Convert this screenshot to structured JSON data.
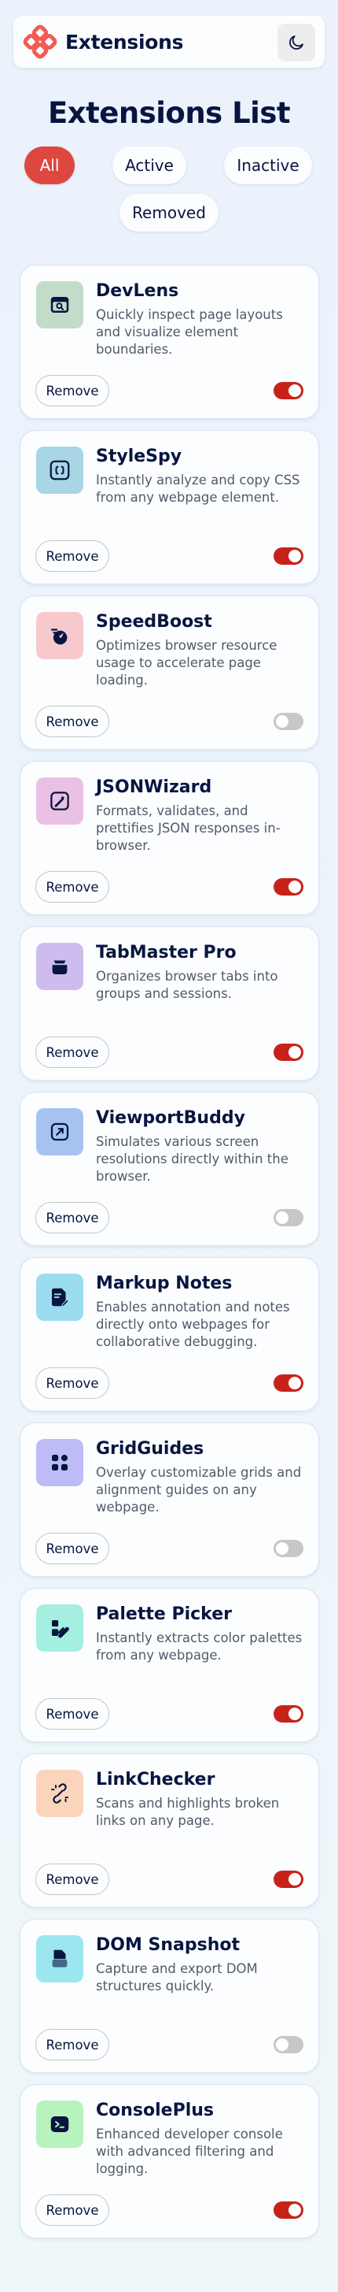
{
  "header": {
    "logo_text": "Extensions",
    "theme_icon": "moon-icon",
    "brand_color": "#f25c54"
  },
  "page": {
    "title": "Extensions List"
  },
  "filters": [
    {
      "label": "All",
      "active": true
    },
    {
      "label": "Active",
      "active": false
    },
    {
      "label": "Inactive",
      "active": false
    },
    {
      "label": "Removed",
      "active": false
    }
  ],
  "remove_label": "Remove",
  "colors": {
    "accent": "#de473f",
    "toggle_on": "#c7221a",
    "toggle_off": "#c7c7c7"
  },
  "extensions": [
    {
      "name": "DevLens",
      "description": "Quickly inspect page layouts and visualize element boundaries.",
      "enabled": true,
      "icon": "inspect-browser-icon",
      "icon_bg": "#c3dbc9"
    },
    {
      "name": "StyleSpy",
      "description": "Instantly analyze and copy CSS from any webpage element.",
      "enabled": true,
      "icon": "code-braces-icon",
      "icon_bg": "#a8d6e5"
    },
    {
      "name": "SpeedBoost",
      "description": "Optimizes browser resource usage to accelerate page loading.",
      "enabled": false,
      "icon": "speedometer-icon",
      "icon_bg": "#f7c9cd"
    },
    {
      "name": "JSONWizard",
      "description": "Formats, validates, and prettifies JSON responses in-browser.",
      "enabled": true,
      "icon": "magic-wand-icon",
      "icon_bg": "#eac1e5"
    },
    {
      "name": "TabMaster Pro",
      "description": "Organizes browser tabs into groups and sessions.",
      "enabled": true,
      "icon": "tab-stack-icon",
      "icon_bg": "#cfbcef"
    },
    {
      "name": "ViewportBuddy",
      "description": "Simulates various screen resolutions directly within the browser.",
      "enabled": false,
      "icon": "resize-arrow-icon",
      "icon_bg": "#a6c3f0"
    },
    {
      "name": "Markup Notes",
      "description": "Enables annotation and notes directly onto webpages for collaborative debugging.",
      "enabled": true,
      "icon": "note-pen-icon",
      "icon_bg": "#9bdcef"
    },
    {
      "name": "GridGuides",
      "description": "Overlay customizable grids and alignment guides on any webpage.",
      "enabled": false,
      "icon": "grid-layout-icon",
      "icon_bg": "#bdbcf6"
    },
    {
      "name": "Palette Picker",
      "description": "Instantly extracts color palettes from any webpage.",
      "enabled": true,
      "icon": "palette-icon",
      "icon_bg": "#a4efe0"
    },
    {
      "name": "LinkChecker",
      "description": "Scans and highlights broken links on any page.",
      "enabled": true,
      "icon": "broken-link-icon",
      "icon_bg": "#fbd4bc"
    },
    {
      "name": "DOM Snapshot",
      "description": "Capture and export DOM structures quickly.",
      "enabled": false,
      "icon": "document-snapshot-icon",
      "icon_bg": "#9ce6f0"
    },
    {
      "name": "ConsolePlus",
      "description": "Enhanced developer console with advanced filtering and logging.",
      "enabled": true,
      "icon": "terminal-icon",
      "icon_bg": "#b8f2bc"
    }
  ]
}
